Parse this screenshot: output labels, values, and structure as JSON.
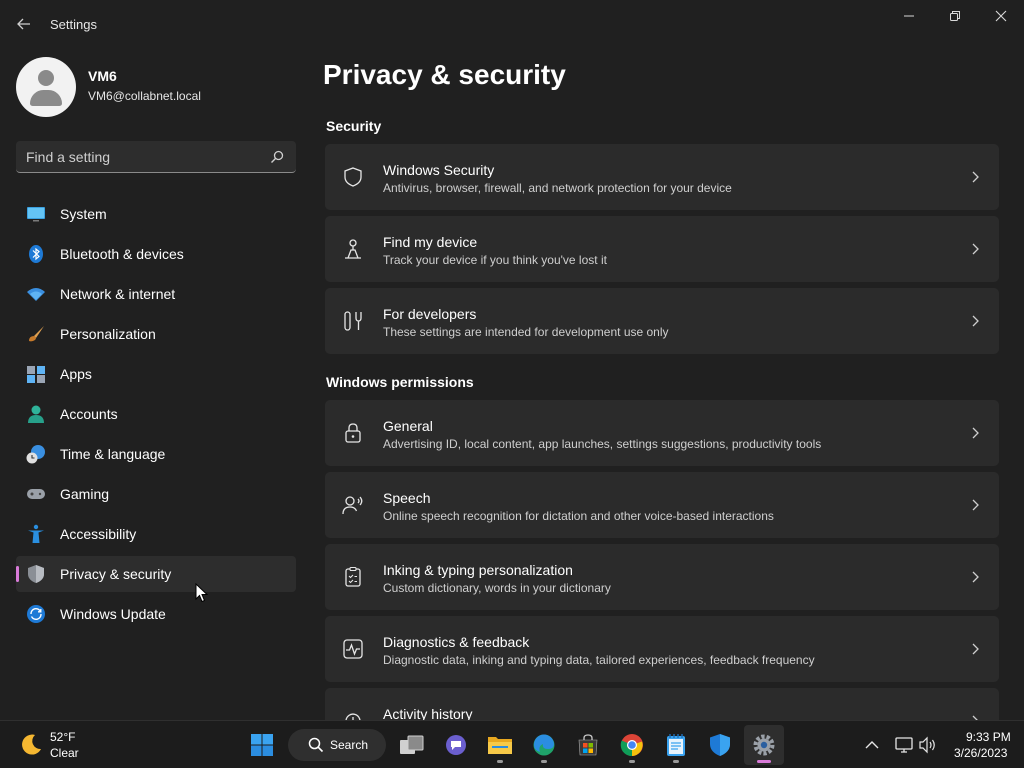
{
  "window": {
    "title": "Settings",
    "back_icon": "back-arrow-icon",
    "controls": [
      "minimize-icon",
      "restore-icon",
      "close-icon"
    ]
  },
  "profile": {
    "name": "VM6",
    "email": "VM6@collabnet.local"
  },
  "search": {
    "placeholder": "Find a setting",
    "icon": "search-icon"
  },
  "sidebar": {
    "items": [
      {
        "label": "System",
        "icon": "system-icon"
      },
      {
        "label": "Bluetooth & devices",
        "icon": "bluetooth-icon"
      },
      {
        "label": "Network & internet",
        "icon": "wifi-icon"
      },
      {
        "label": "Personalization",
        "icon": "brush-icon"
      },
      {
        "label": "Apps",
        "icon": "apps-icon"
      },
      {
        "label": "Accounts",
        "icon": "accounts-icon"
      },
      {
        "label": "Time & language",
        "icon": "clock-globe-icon"
      },
      {
        "label": "Gaming",
        "icon": "gamepad-icon"
      },
      {
        "label": "Accessibility",
        "icon": "accessibility-icon"
      },
      {
        "label": "Privacy & security",
        "icon": "shield-icon",
        "selected": true
      },
      {
        "label": "Windows Update",
        "icon": "update-icon"
      }
    ]
  },
  "main": {
    "title": "Privacy & security",
    "sections": [
      {
        "title": "Security",
        "cards": [
          {
            "title": "Windows Security",
            "desc": "Antivirus, browser, firewall, and network protection for your device",
            "icon": "shield-outline-icon"
          },
          {
            "title": "Find my device",
            "desc": "Track your device if you think you've lost it",
            "icon": "person-pin-icon"
          },
          {
            "title": "For developers",
            "desc": "These settings are intended for development use only",
            "icon": "tools-icon"
          }
        ]
      },
      {
        "title": "Windows permissions",
        "cards": [
          {
            "title": "General",
            "desc": "Advertising ID, local content, app launches, settings suggestions, productivity tools",
            "icon": "lock-icon"
          },
          {
            "title": "Speech",
            "desc": "Online speech recognition for dictation and other voice-based interactions",
            "icon": "speech-icon"
          },
          {
            "title": "Inking & typing personalization",
            "desc": "Custom dictionary, words in your dictionary",
            "icon": "clipboard-check-icon"
          },
          {
            "title": "Diagnostics & feedback",
            "desc": "Diagnostic data, inking and typing data, tailored experiences, feedback frequency",
            "icon": "pulse-icon"
          },
          {
            "title": "Activity history",
            "desc": "",
            "icon": "history-icon"
          }
        ]
      }
    ]
  },
  "taskbar": {
    "weather": {
      "temp": "52°F",
      "condition": "Clear",
      "icon": "moon-icon"
    },
    "search_label": "Search",
    "apps": [
      "start-icon",
      "task-view-icon",
      "teams-chat-icon",
      "file-explorer-icon",
      "edge-icon",
      "store-icon",
      "chrome-icon",
      "notepad-icon",
      "defender-icon",
      "settings-gear-icon"
    ],
    "tray": [
      "chevron-up-icon",
      "network-icon",
      "volume-icon"
    ],
    "time": "9:33 PM",
    "date": "3/26/2023"
  },
  "colors": {
    "background": "#202020",
    "card": "#2b2b2b",
    "accent": "#d97bd9"
  }
}
